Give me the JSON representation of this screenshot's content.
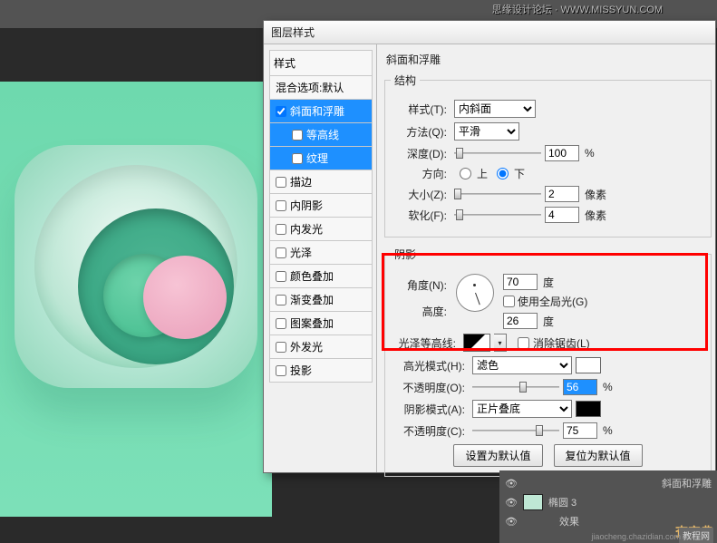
{
  "watermark_top": "思缘设计论坛 · WWW.MISSYUN.COM",
  "dialog": {
    "title": "图层样式"
  },
  "styles": {
    "header": "样式",
    "blend_default": "混合选项:默认",
    "bevel": "斜面和浮雕",
    "contour": "等高线",
    "texture": "纹理",
    "stroke": "描边",
    "inner_shadow": "内阴影",
    "inner_glow": "内发光",
    "satin": "光泽",
    "color_overlay": "颜色叠加",
    "gradient_overlay": "渐变叠加",
    "pattern_overlay": "图案叠加",
    "outer_glow": "外发光",
    "drop_shadow": "投影"
  },
  "bevel_panel": {
    "title": "斜面和浮雕",
    "structure_legend": "结构",
    "style_label": "样式(T):",
    "style_value": "内斜面",
    "technique_label": "方法(Q):",
    "technique_value": "平滑",
    "depth_label": "深度(D):",
    "depth_value": "100",
    "pct": "%",
    "direction_label": "方向:",
    "direction_up": "上",
    "direction_down": "下",
    "size_label": "大小(Z):",
    "size_value": "2",
    "px": "像素",
    "soften_label": "软化(F):",
    "soften_value": "4",
    "shading_legend": "阴影",
    "angle_label": "角度(N):",
    "angle_value": "70",
    "deg": "度",
    "global_light": "使用全局光(G)",
    "altitude_label": "高度:",
    "altitude_value": "26",
    "gloss_contour_label": "光泽等高线:",
    "anti_alias": "消除锯齿(L)",
    "highlight_mode_label": "高光模式(H):",
    "highlight_mode_value": "滤色",
    "highlight_opacity_label": "不透明度(O):",
    "highlight_opacity_value": "56",
    "shadow_mode_label": "阴影模式(A):",
    "shadow_mode_value": "正片叠底",
    "shadow_opacity_label": "不透明度(C):",
    "shadow_opacity_value": "75",
    "btn_default": "设置为默认值",
    "btn_reset": "复位为默认值"
  },
  "layers": {
    "row_bevel": "斜面和浮雕",
    "ellipse": "椭圆 3",
    "effects": "效果"
  },
  "colors": {
    "highlight_swatch": "#ffffff",
    "shadow_swatch": "#000000"
  },
  "watermark_brand": "查字典",
  "watermark_box": "教程网",
  "watermark_url": "jiaocheng.chazidian.com"
}
